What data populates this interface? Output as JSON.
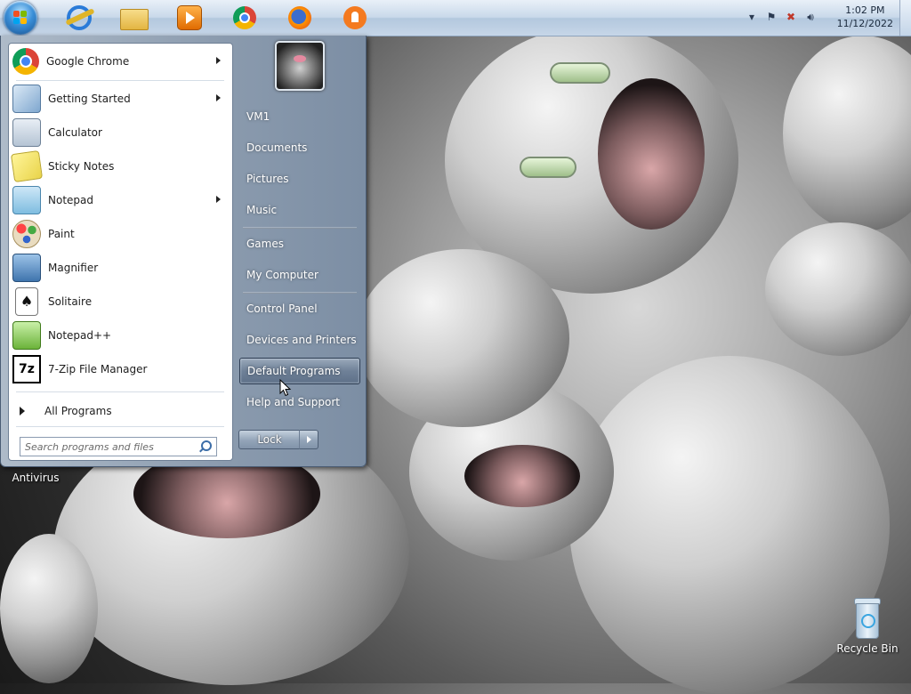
{
  "taskbar": {
    "pinned": [
      {
        "name": "Internet Explorer",
        "icon": "ie-icon"
      },
      {
        "name": "Windows Explorer",
        "icon": "folder-icon"
      },
      {
        "name": "Windows Media Player",
        "icon": "media-player-icon"
      },
      {
        "name": "Google Chrome",
        "icon": "chrome-icon"
      },
      {
        "name": "Firefox",
        "icon": "firefox-icon"
      },
      {
        "name": "Avast",
        "icon": "avast-icon"
      }
    ],
    "clock": {
      "time": "1:02 PM",
      "date": "11/12/2022"
    }
  },
  "start_menu": {
    "programs": [
      {
        "label": "Google Chrome",
        "icon": "chrome-icon",
        "has_submenu": true
      },
      {
        "label": "Getting Started",
        "icon": "getting-started-icon",
        "has_submenu": true
      },
      {
        "label": "Calculator",
        "icon": "calculator-icon",
        "has_submenu": false
      },
      {
        "label": "Sticky Notes",
        "icon": "sticky-notes-icon",
        "has_submenu": false
      },
      {
        "label": "Notepad",
        "icon": "notepad-icon",
        "has_submenu": true
      },
      {
        "label": "Paint",
        "icon": "paint-icon",
        "has_submenu": false
      },
      {
        "label": "Magnifier",
        "icon": "magnifier-icon",
        "has_submenu": false
      },
      {
        "label": "Solitaire",
        "icon": "solitaire-icon",
        "has_submenu": false
      },
      {
        "label": "Notepad++",
        "icon": "notepadpp-icon",
        "has_submenu": false
      },
      {
        "label": "7-Zip File Manager",
        "icon": "seven-zip-icon",
        "has_submenu": false
      }
    ],
    "all_programs": "All Programs",
    "search_placeholder": "Search programs and files",
    "right_items": [
      {
        "label": "VM1"
      },
      {
        "label": "Documents"
      },
      {
        "label": "Pictures"
      },
      {
        "label": "Music"
      },
      {
        "label": "Games"
      },
      {
        "label": "My Computer"
      },
      {
        "label": "Control Panel"
      },
      {
        "label": "Devices and Printers"
      },
      {
        "label": "Default Programs",
        "highlighted": true
      },
      {
        "label": "Help and Support"
      }
    ],
    "lock_label": "Lock"
  },
  "desktop": {
    "icons": [
      {
        "label": "Antivirus"
      },
      {
        "label": "Recycle Bin"
      }
    ]
  },
  "colors": {
    "taskbar": "#c9d9ea",
    "start_menu_right": "#8b9bae",
    "hover": "#6f8198"
  }
}
